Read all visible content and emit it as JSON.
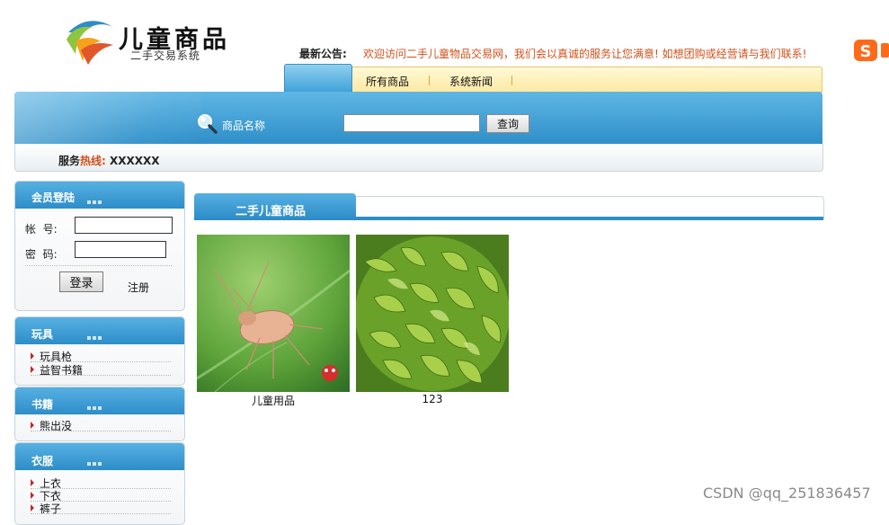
{
  "header": {
    "logo_title": "儿童商品",
    "logo_subtitle": "二手交易系统",
    "notice_label": "最新公告:",
    "notice_text": "欢迎访问二手儿童物品交易网，我们会以真诚的服务让您满意! 如想团购或经营请与我们联系!"
  },
  "nav": {
    "items": [
      "所有商品",
      "系统新闻"
    ]
  },
  "search": {
    "label": "商品名称",
    "input_value": "",
    "button_label": "查询"
  },
  "hotline": {
    "prefix": "服务",
    "hot": "热线:",
    "number": "XXXXXX"
  },
  "login": {
    "title": "会员登陆",
    "account_label": "帐  号:",
    "password_label": "密  码:",
    "account_value": "",
    "password_value": "",
    "login_button": "登录",
    "register_link": "注册"
  },
  "categories": [
    {
      "title": "玩具",
      "items": [
        "玩具枪",
        "益智书籍"
      ]
    },
    {
      "title": "书籍",
      "items": [
        "熊出没"
      ]
    },
    {
      "title": "衣服",
      "items": [
        "上衣",
        "下衣",
        "裤子"
      ]
    }
  ],
  "main": {
    "section_title": "二手儿童商品",
    "products": [
      {
        "name": "儿童用品",
        "image": "aphid-on-leaf-photo"
      },
      {
        "name": "123",
        "image": "green-tea-leaves-photo"
      }
    ]
  },
  "watermark": "CSDN @qq_251836457",
  "colors": {
    "header_blue": "#2e8dc8",
    "notice_orange": "#d2511a",
    "nav_yellow": "#fde9a3"
  }
}
